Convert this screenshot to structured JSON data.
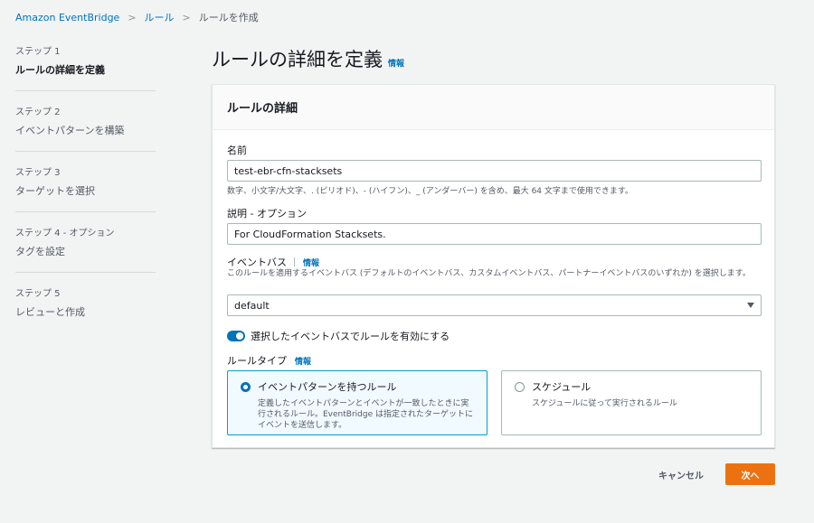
{
  "breadcrumb": {
    "items": [
      "Amazon EventBridge",
      "ルール"
    ],
    "current": "ルールを作成",
    "separator": ">"
  },
  "steps": [
    {
      "num": "ステップ 1",
      "title": "ルールの詳細を定義",
      "active": true
    },
    {
      "num": "ステップ 2",
      "title": "イベントパターンを構築",
      "active": false
    },
    {
      "num": "ステップ 3",
      "title": "ターゲットを選択",
      "active": false
    },
    {
      "num": "ステップ 4 - オプション",
      "title": "タグを設定",
      "active": false
    },
    {
      "num": "ステップ 5",
      "title": "レビューと作成",
      "active": false
    }
  ],
  "page": {
    "title": "ルールの詳細を定義",
    "info": "情報"
  },
  "panel": {
    "title": "ルールの詳細",
    "name": {
      "label": "名前",
      "value": "test-ebr-cfn-stacksets",
      "hint": "数字、小文字/大文字、. (ピリオド)、- (ハイフン)、_ (アンダーバー) を含め、最大 64 文字まで使用できます。"
    },
    "description": {
      "label": "説明 - オプション",
      "value": "For CloudFormation Stacksets."
    },
    "event_bus": {
      "label": "イベントバス",
      "info": "情報",
      "hint": "このルールを適用するイベントバス (デフォルトのイベントバス、カスタムイベントバス、パートナーイベントバスのいずれか) を選択します。",
      "selected": "default"
    },
    "toggle": {
      "label": "選択したイベントバスでルールを有効にする",
      "on": true
    },
    "rule_type": {
      "label": "ルールタイプ",
      "info": "情報",
      "options": [
        {
          "title": "イベントパターンを持つルール",
          "desc": "定義したイベントパターンとイベントが一致したときに実行されるルール。EventBridge は指定されたターゲットにイベントを送信します。",
          "selected": true
        },
        {
          "title": "スケジュール",
          "desc": "スケジュールに従って実行されるルール",
          "selected": false
        }
      ]
    }
  },
  "footer": {
    "cancel": "キャンセル",
    "next": "次へ"
  },
  "colors": {
    "accent": "#0073bb",
    "primary_button": "#ec7211",
    "background": "#f2f3f3"
  },
  "icons": {
    "breadcrumb_separator": "chevron-right-icon",
    "select_caret": "caret-down-icon"
  }
}
